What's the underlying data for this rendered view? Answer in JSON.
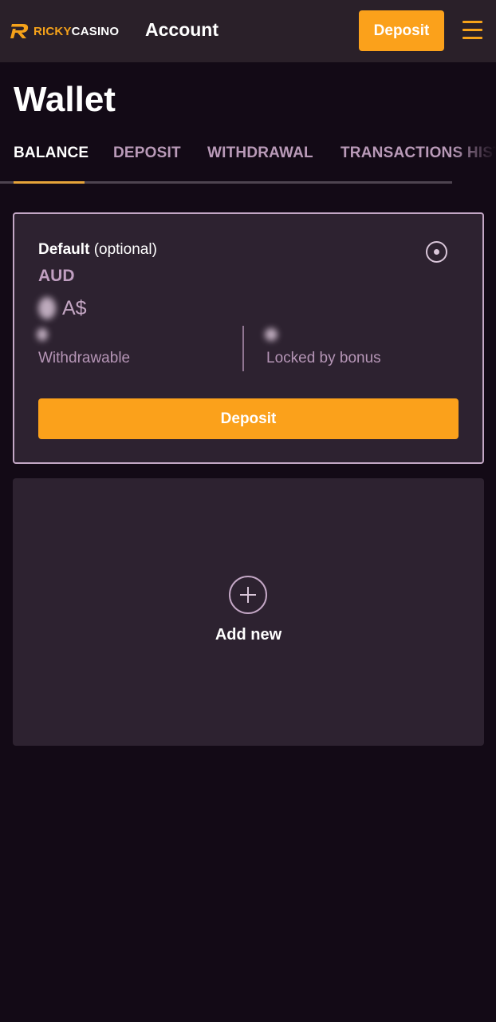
{
  "header": {
    "logo_part1": "RICKY",
    "logo_part2": "CASINO",
    "title": "Account",
    "deposit_label": "Deposit",
    "brand_color": "#fba11b"
  },
  "page": {
    "title": "Wallet"
  },
  "tabs": [
    {
      "label": "BALANCE",
      "active": true
    },
    {
      "label": "DEPOSIT",
      "active": false
    },
    {
      "label": "WITHDRAWAL",
      "active": false
    },
    {
      "label": "TRANSACTIONS HISTORY",
      "active": false
    }
  ],
  "wallet": {
    "default_label": "Default",
    "optional_label": "(optional)",
    "currency": "AUD",
    "currency_symbol": "A$",
    "withdrawable_label": "Withdrawable",
    "locked_label": "Locked by bonus",
    "deposit_label": "Deposit",
    "selected": true
  },
  "add_new": {
    "label": "Add new",
    "icon": "plus-icon"
  }
}
